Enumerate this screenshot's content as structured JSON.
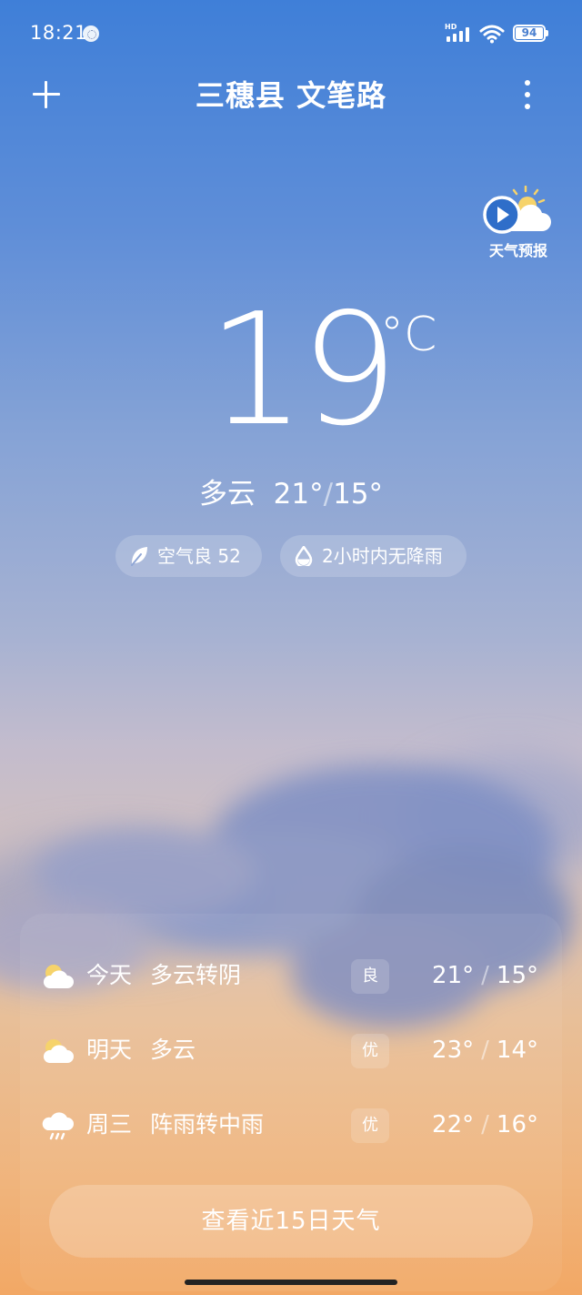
{
  "status_bar": {
    "time": "18:21",
    "network_label": "HD",
    "battery": "94"
  },
  "header": {
    "location": "三穗县 文笔路"
  },
  "forecast_video": {
    "label": "天气预报"
  },
  "current": {
    "temperature": "19",
    "unit": "°C",
    "condition": "多云",
    "high": "21°",
    "separator": "/",
    "low": "15°",
    "air_quality": "空气良 52",
    "precipitation": "2小时内无降雨"
  },
  "daily": [
    {
      "day": "今天",
      "condition": "多云转阴",
      "aqi": "良",
      "high": "21°",
      "low": "15°",
      "icon": "cloudy-icon"
    },
    {
      "day": "明天",
      "condition": "多云",
      "aqi": "优",
      "high": "23°",
      "low": "14°",
      "icon": "partly-cloudy-icon"
    },
    {
      "day": "周三",
      "condition": "阵雨转中雨",
      "aqi": "优",
      "high": "22°",
      "low": "16°",
      "icon": "rain-icon"
    }
  ],
  "fifteen_day_button": "查看近15日天气",
  "colors": {
    "sky_top": "#3f7fd8",
    "sky_bottom": "#f2a865",
    "text": "#ffffff",
    "sun": "#f6d36b"
  }
}
